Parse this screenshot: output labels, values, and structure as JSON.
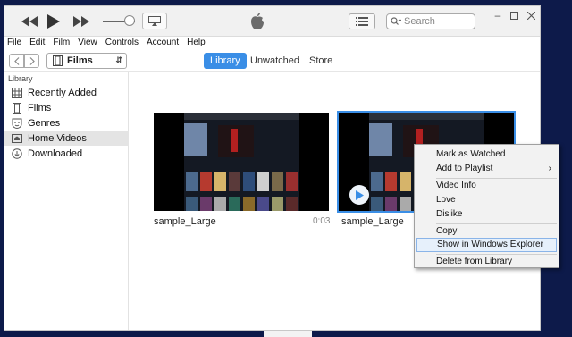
{
  "window": {
    "search_placeholder": "Search"
  },
  "menubar": [
    "File",
    "Edit",
    "Film",
    "View",
    "Controls",
    "Account",
    "Help"
  ],
  "nav": {
    "media_type": "Films",
    "tabs": [
      "Library",
      "Unwatched",
      "Store"
    ],
    "active_tab": "Library"
  },
  "sidebar": {
    "heading": "Library",
    "items": [
      {
        "label": "Recently Added",
        "icon": "grid-icon"
      },
      {
        "label": "Films",
        "icon": "film-icon"
      },
      {
        "label": "Genres",
        "icon": "theater-masks-icon"
      },
      {
        "label": "Home Videos",
        "icon": "home-video-icon",
        "selected": true
      },
      {
        "label": "Downloaded",
        "icon": "download-icon"
      }
    ]
  },
  "videos": [
    {
      "title": "sample_Large",
      "duration": "0:03"
    },
    {
      "title": "sample_Large"
    }
  ],
  "context_menu": {
    "items": [
      "Mark as Watched",
      "Add to Playlist",
      "Video Info",
      "Love",
      "Dislike",
      "Copy",
      "Show in Windows Explorer",
      "Delete from Library"
    ],
    "highlighted": "Show in Windows Explorer"
  },
  "colors": {
    "accent": "#3a8ee6",
    "background": "#0d1a4a"
  }
}
